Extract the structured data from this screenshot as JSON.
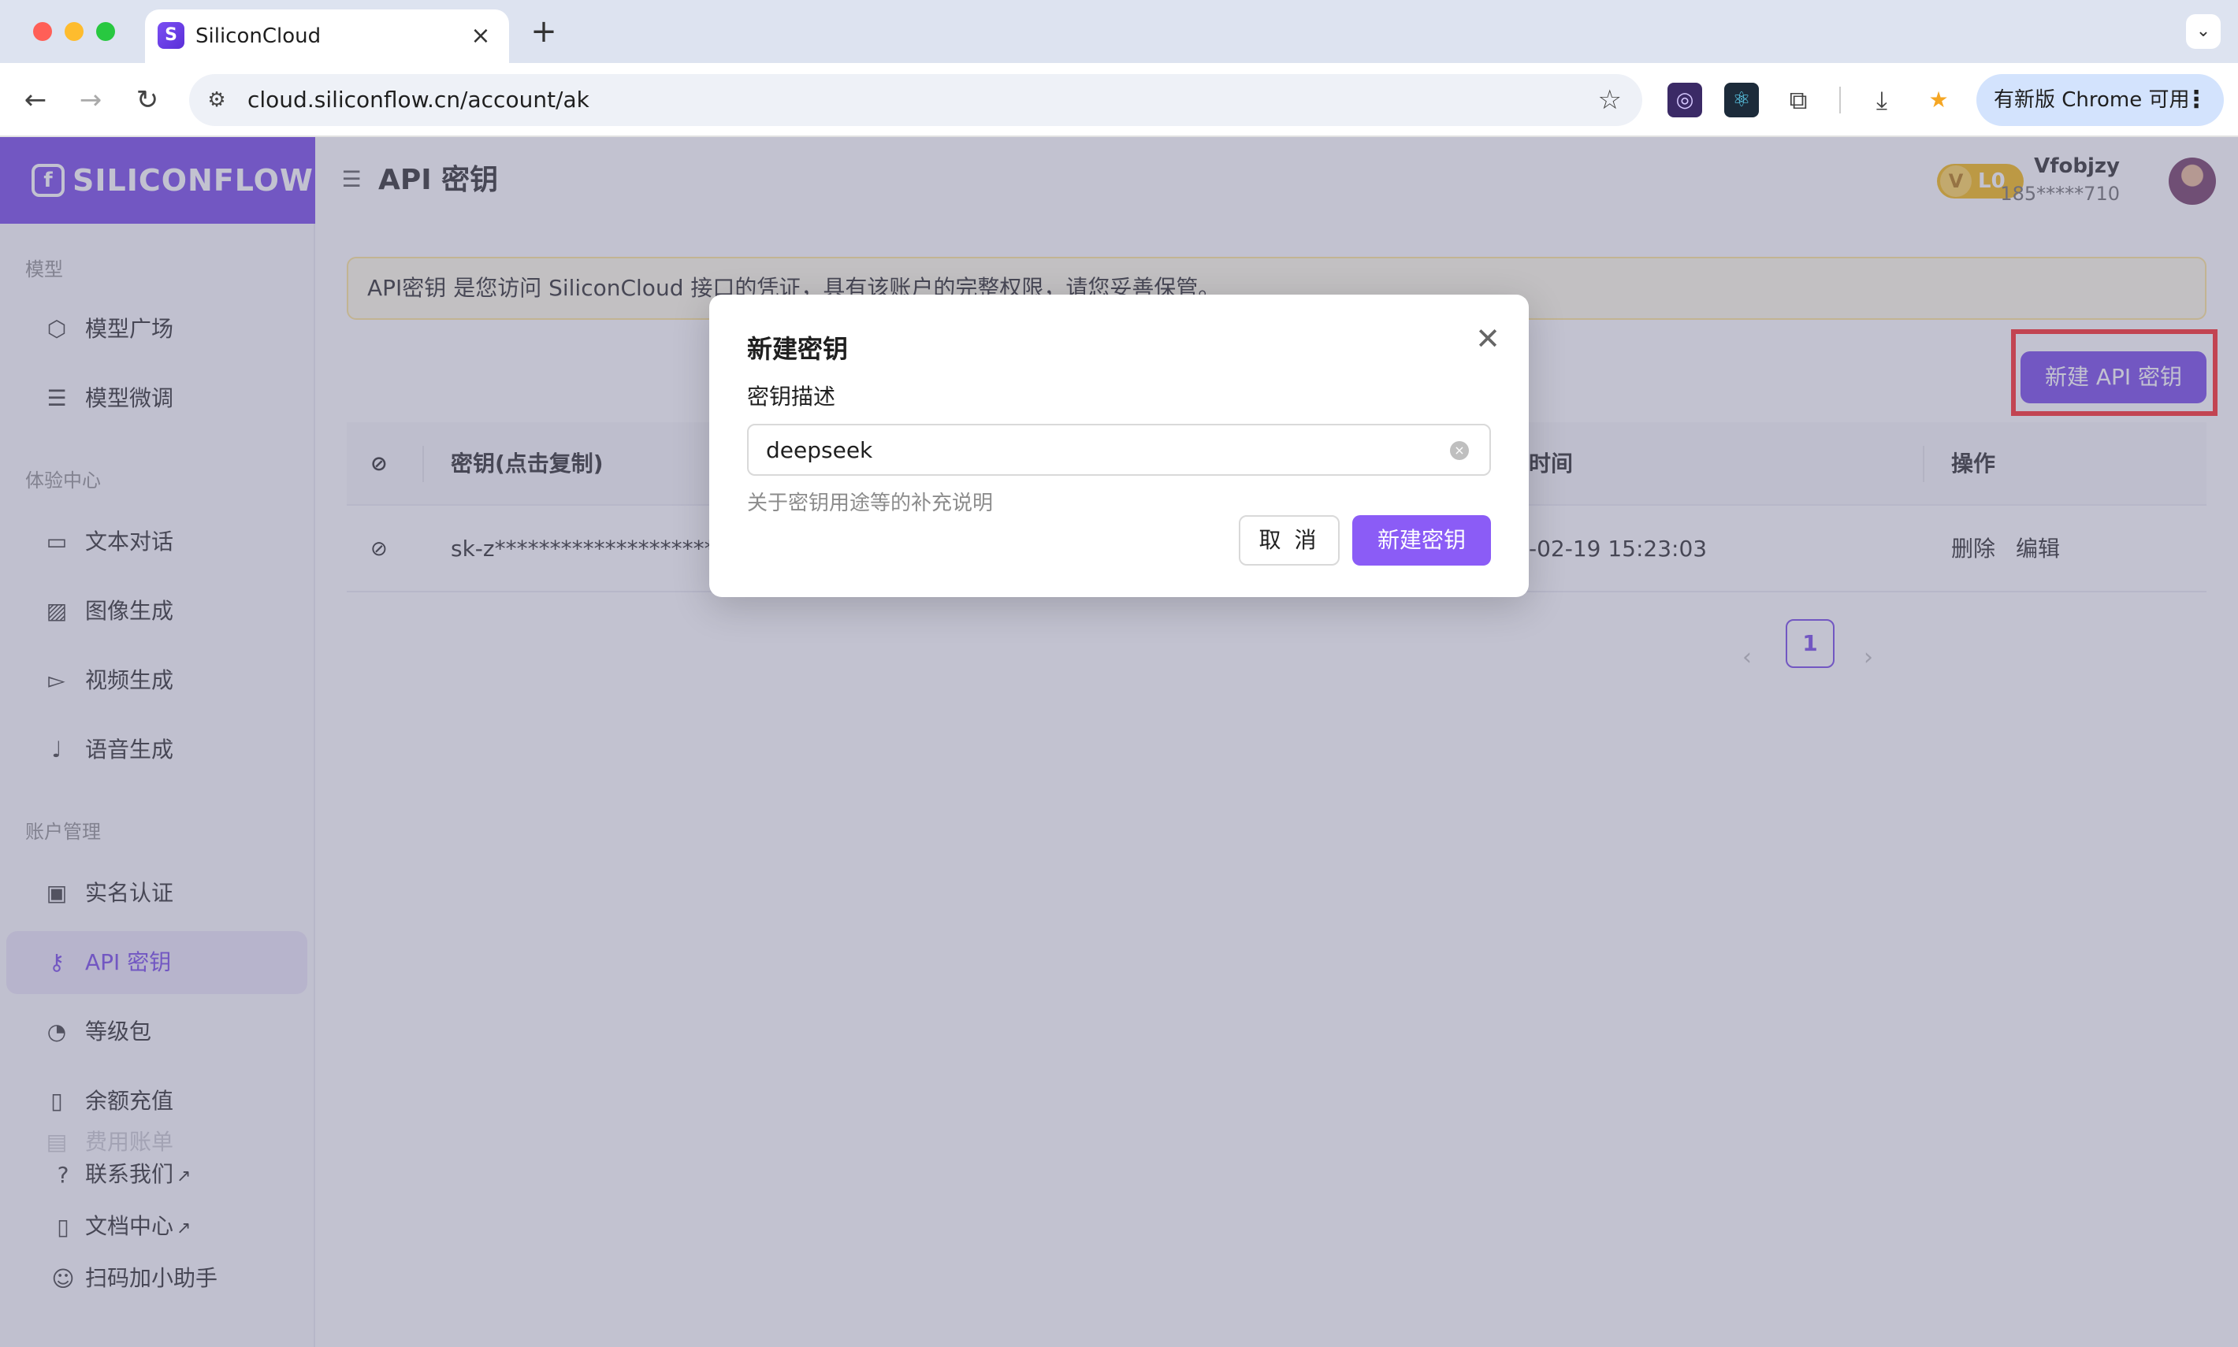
{
  "browser": {
    "tab_title": "SiliconCloud",
    "url": "cloud.siliconflow.cn/account/ak",
    "update_label": "有新版 Chrome 可用"
  },
  "sidebar": {
    "logo_text": "SILICONFLOW",
    "sections": [
      {
        "label": "模型",
        "items": [
          {
            "label": "模型广场",
            "icon": "cube-icon"
          },
          {
            "label": "模型微调",
            "icon": "sliders-icon"
          }
        ]
      },
      {
        "label": "体验中心",
        "items": [
          {
            "label": "文本对话",
            "icon": "chat-icon"
          },
          {
            "label": "图像生成",
            "icon": "image-icon"
          },
          {
            "label": "视频生成",
            "icon": "video-icon"
          },
          {
            "label": "语音生成",
            "icon": "mic-icon"
          }
        ]
      },
      {
        "label": "账户管理",
        "items": [
          {
            "label": "实名认证",
            "icon": "id-card-icon"
          },
          {
            "label": "API 密钥",
            "icon": "key-icon"
          },
          {
            "label": "等级包",
            "icon": "gauge-icon"
          },
          {
            "label": "余额充值",
            "icon": "wallet-icon"
          },
          {
            "label": "费用账单",
            "icon": "bill-icon"
          }
        ]
      }
    ],
    "footer": [
      {
        "label": "联系我们",
        "icon": "help-icon"
      },
      {
        "label": "文档中心",
        "icon": "book-icon"
      },
      {
        "label": "扫码加小助手",
        "icon": "people-icon"
      }
    ]
  },
  "header": {
    "title": "API 密钥",
    "level": "L0",
    "level_mark": "V",
    "user_name": "Vfobjzy",
    "user_phone": "185*****710"
  },
  "notice": "API密钥 是您访问 SiliconCloud 接口的凭证，具有该账户的完整权限，请您妥善保管。",
  "new_key_button": "新建 API 密钥",
  "table": {
    "headers": {
      "key": "密钥(点击复制)",
      "time": "时间",
      "actions": "操作"
    },
    "rows": [
      {
        "key": "sk-z**********************",
        "time": "-02-19 15:23:03",
        "delete": "删除",
        "edit": "编辑"
      }
    ]
  },
  "pagination": {
    "current": "1"
  },
  "modal": {
    "title": "新建密钥",
    "field_label": "密钥描述",
    "input_value": "deepseek",
    "help": "关于密钥用途等的补充说明",
    "cancel": "取 消",
    "confirm": "新建密钥"
  },
  "colors": {
    "brand": "#6d3ce6",
    "confirm_button": "#8b5cf6",
    "danger": "#e0282e",
    "highlight_box": "#ff1a1a"
  }
}
